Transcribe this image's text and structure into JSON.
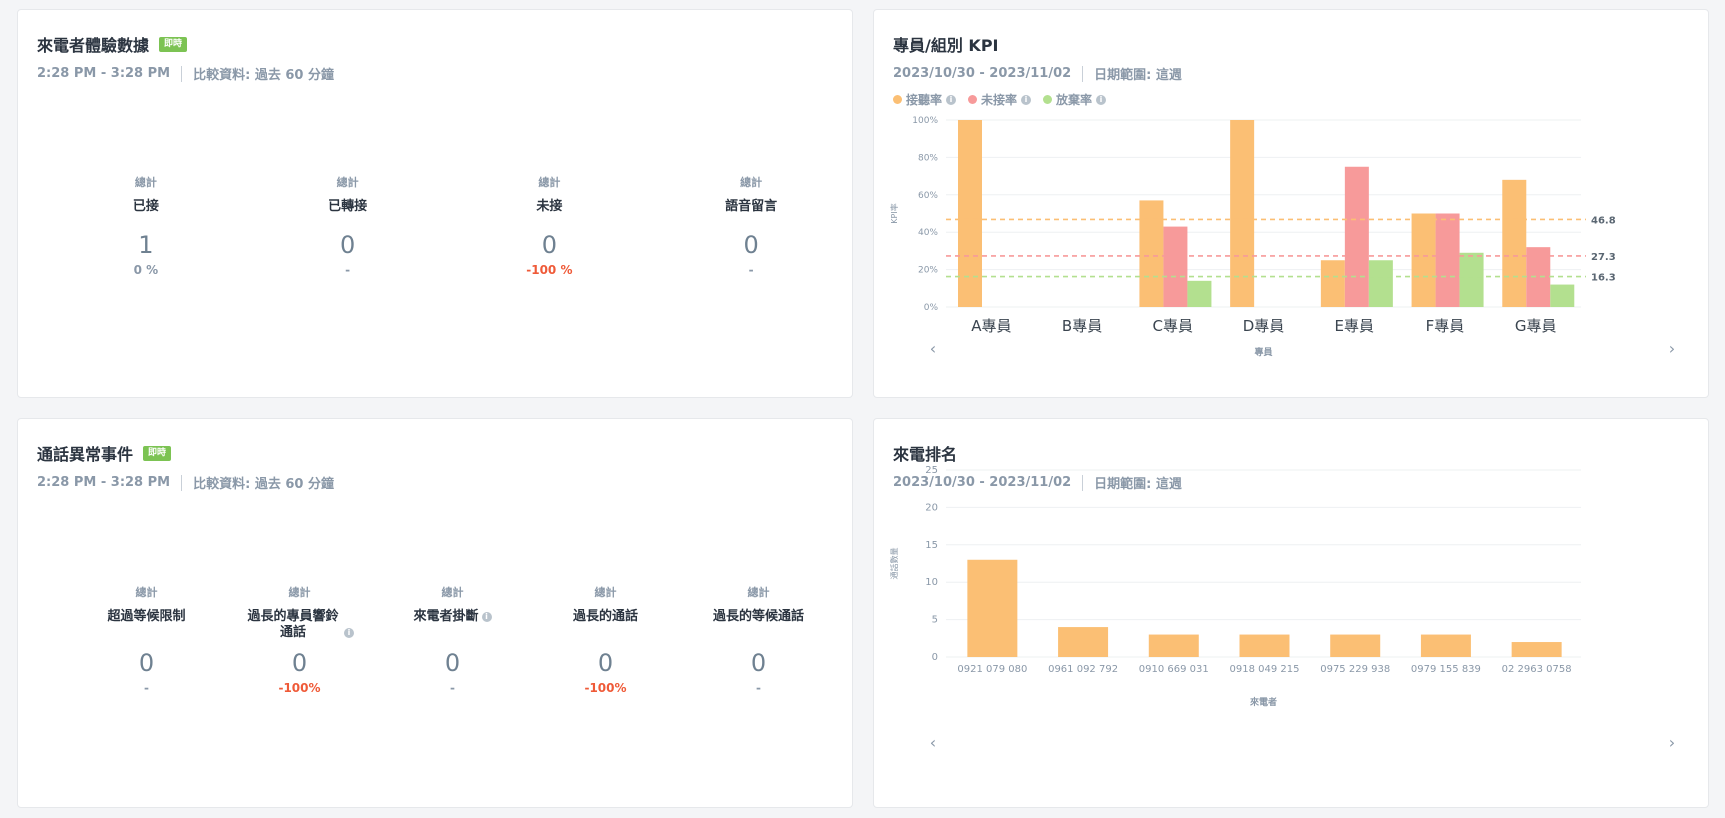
{
  "experience": {
    "title": "來電者體驗數據",
    "badge": "即時",
    "time_range": "2:28 PM - 3:28 PM",
    "compare": "比較資料: 過去 60 分鐘",
    "metrics": [
      {
        "total": "總計",
        "label": "已接",
        "value": "1",
        "change": "0 %",
        "negative": false
      },
      {
        "total": "總計",
        "label": "已轉接",
        "value": "0",
        "change": "-",
        "negative": false
      },
      {
        "total": "總計",
        "label": "未接",
        "value": "0",
        "change": "-100 %",
        "negative": true
      },
      {
        "total": "總計",
        "label": "語音留言",
        "value": "0",
        "change": "-",
        "negative": false
      }
    ]
  },
  "kpi": {
    "title": "專員/組別 KPI",
    "date_range": "2023/10/30 - 2023/11/02",
    "range_label": "日期範圍: 這週",
    "legend": [
      {
        "name": "接聽率",
        "color": "#fbbf74"
      },
      {
        "name": "未接率",
        "color": "#f79a9a"
      },
      {
        "name": "放棄率",
        "color": "#b3e08f"
      }
    ]
  },
  "abnormal": {
    "title": "通話異常事件",
    "badge": "即時",
    "time_range": "2:28 PM - 3:28 PM",
    "compare": "比較資料: 過去 60 分鐘",
    "metrics": [
      {
        "total": "總計",
        "label": "超過等候限制",
        "value": "0",
        "change": "-",
        "negative": false,
        "info": false
      },
      {
        "total": "總計",
        "label": "過長的專員響鈴通話",
        "value": "0",
        "change": "-100%",
        "negative": true,
        "info": true
      },
      {
        "total": "總計",
        "label": "來電者掛斷",
        "value": "0",
        "change": "-",
        "negative": false,
        "info": true
      },
      {
        "total": "總計",
        "label": "過長的通話",
        "value": "0",
        "change": "-100%",
        "negative": true,
        "info": false
      },
      {
        "total": "總計",
        "label": "過長的等候通話",
        "value": "0",
        "change": "-",
        "negative": false,
        "info": false
      }
    ]
  },
  "ranking": {
    "title": "來電排名",
    "date_range": "2023/10/30 - 2023/11/02",
    "range_label": "日期範圍: 這週"
  },
  "chart_data": [
    {
      "type": "bar",
      "xlabel": "專員",
      "ylabel": "KPI率",
      "ylim": [
        0,
        100
      ],
      "yticks": [
        "0%",
        "20%",
        "40%",
        "60%",
        "80%",
        "100%"
      ],
      "categories": [
        "A專員",
        "B專員",
        "C專員",
        "D專員",
        "E專員",
        "F專員",
        "G專員"
      ],
      "series": [
        {
          "name": "接聽率",
          "color": "#fbbf74",
          "values": [
            100,
            0,
            57,
            100,
            25,
            50,
            68
          ]
        },
        {
          "name": "未接率",
          "color": "#f79a9a",
          "values": [
            0,
            0,
            43,
            0,
            75,
            50,
            32
          ]
        },
        {
          "name": "放棄率",
          "color": "#b3e08f",
          "values": [
            0,
            0,
            14,
            0,
            25,
            29,
            12
          ]
        }
      ],
      "reference_lines": [
        {
          "value": 46.8,
          "label": "46.8",
          "color": "#fbbf74"
        },
        {
          "value": 27.3,
          "label": "27.3",
          "color": "#f79a9a"
        },
        {
          "value": 16.3,
          "label": "16.3",
          "color": "#b3e08f"
        }
      ],
      "grid": true
    },
    {
      "type": "bar",
      "xlabel": "來電者",
      "ylabel": "通話數量",
      "ylim": [
        0,
        25
      ],
      "yticks": [
        "0",
        "5",
        "10",
        "15",
        "20",
        "25"
      ],
      "categories": [
        "0921 079 080",
        "0961 092 792",
        "0910 669 031",
        "0918 049 215",
        "0975 229 938",
        "0979 155 839",
        "02 2963 0758"
      ],
      "values": [
        13,
        4,
        3,
        3,
        3,
        3,
        2
      ],
      "color": "#fbbf74",
      "grid": true
    }
  ]
}
